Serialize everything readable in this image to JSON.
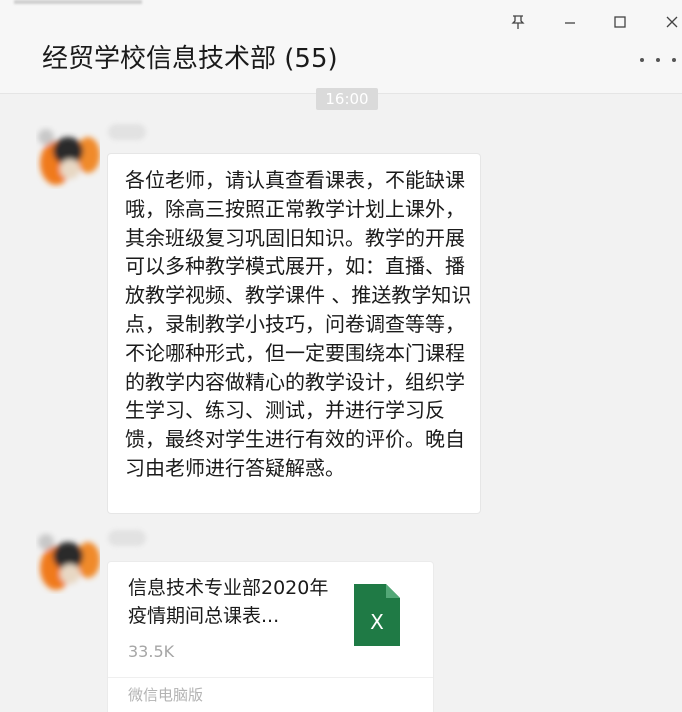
{
  "window": {
    "title": "经贸学校信息技术部 (55)",
    "controls": {
      "pin_icon": "pin-icon",
      "minimize_icon": "minimize-icon",
      "maximize_icon": "maximize-icon",
      "close_icon": "close-icon",
      "more_icon": "more-icon"
    }
  },
  "timestamp": "16:00",
  "messages": [
    {
      "type": "text",
      "text": "各位老师，请认真查看课表，不能缺课哦，除高三按照正常教学计划上课外，其余班级复习巩固旧知识。教学的开展可以多种教学模式展开，如：直播、播放教学视频、教学课件 、推送教学知识点，录制教学小技巧，问卷调查等等，不论哪种形式，但一定要围绕本门课程的教学内容做精心的教学设计，组织学生学习、练习、测试，并进行学习反馈，最终对学生进行有效的评价。晚自习由老师进行答疑解惑。"
    },
    {
      "type": "file",
      "file_name": "信息技术专业部2020年疫情期间总课表...",
      "file_size": "33.5K",
      "file_icon_label": "X",
      "source": "微信电脑版"
    }
  ],
  "colors": {
    "background": "#f2f2f2",
    "header": "#f7f7f7",
    "bubble": "#ffffff",
    "excel_green": "#1f7a45",
    "excel_fold": "#53a877",
    "muted_text": "#a6a6a6"
  }
}
